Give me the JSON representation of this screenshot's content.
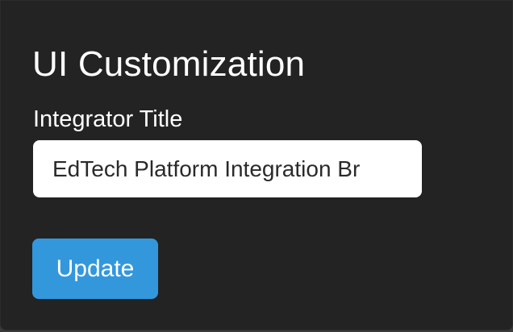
{
  "section": {
    "title": "UI Customization"
  },
  "integrator_title": {
    "label": "Integrator Title",
    "value": "EdTech Platform Integration Br"
  },
  "actions": {
    "update_label": "Update"
  },
  "colors": {
    "panel_background": "#232323",
    "accent": "#3397dc",
    "text": "#ffffff",
    "input_background": "#ffffff"
  }
}
